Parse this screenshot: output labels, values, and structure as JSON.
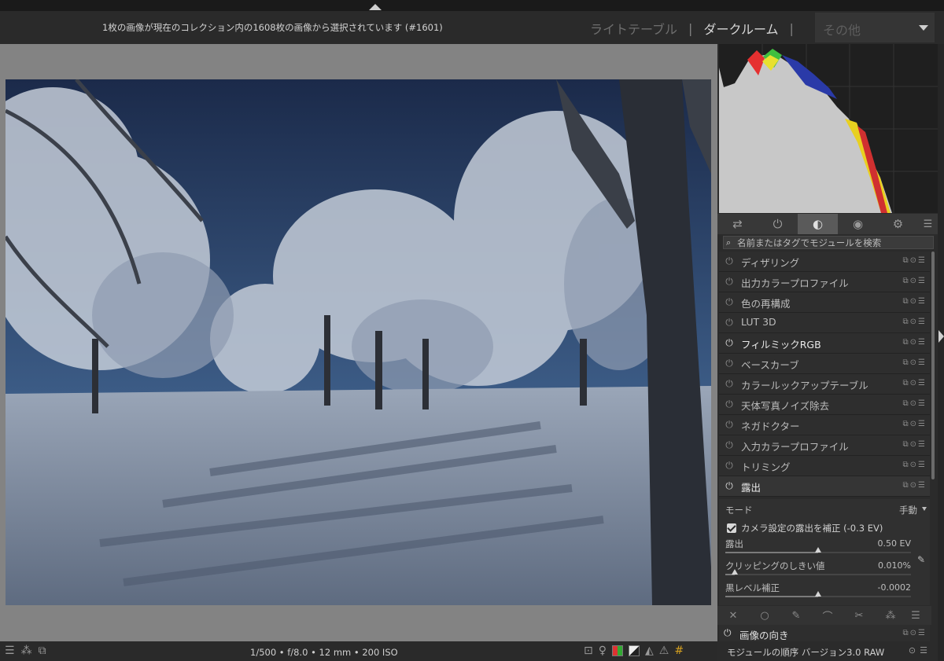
{
  "header": {
    "info": "1枚の画像が現在のコレクション内の1608枚の画像から選択されています (#1601)",
    "views": [
      {
        "label": "ライトテーブル",
        "active": false
      },
      {
        "label": "ダークルーム",
        "active": true
      }
    ],
    "separator": "|",
    "other_label": "その他"
  },
  "panel": {
    "tabs": [
      "⇄",
      "⏻",
      "◐",
      "◉",
      "⚙",
      "☰"
    ],
    "search": {
      "placeholder": "名前またはタグでモジュールを検索"
    },
    "modules": [
      {
        "name": "ディザリング",
        "on": false
      },
      {
        "name": "出力カラープロファイル",
        "on": false
      },
      {
        "name": "色の再構成",
        "on": false
      },
      {
        "name": "LUT 3D",
        "on": false
      },
      {
        "name": "フィルミックRGB",
        "on": true
      },
      {
        "name": "ベースカーブ",
        "on": false
      },
      {
        "name": "カラールックアップテーブル",
        "on": false
      },
      {
        "name": "天体写真ノイズ除去",
        "on": false
      },
      {
        "name": "ネガドクター",
        "on": false
      },
      {
        "name": "入力カラープロファイル",
        "on": false
      },
      {
        "name": "トリミング",
        "on": false
      },
      {
        "name": "露出",
        "on": true
      }
    ],
    "exposure": {
      "mode_label": "モード",
      "mode_value": "手動",
      "compensate_label": "カメラ設定の露出を補正 (-0.3 EV)",
      "compensate_checked": true,
      "sliders": [
        {
          "label": "露出",
          "value": "0.50 EV",
          "position": 0.5
        },
        {
          "label": "クリッピングのしきい値",
          "value": "0.010%",
          "position": 0.05
        },
        {
          "label": "黒レベル補正",
          "value": "-0.0002",
          "position": 0.5
        }
      ]
    },
    "mask_icons": [
      "✕",
      "○",
      "✎",
      "⌒",
      "✂",
      "⁂",
      "☰"
    ],
    "orientation_module": "画像の向き",
    "footer": {
      "order_label": "モジュールの順序",
      "version": "バージョン3.0 RAW"
    }
  },
  "bottom": {
    "exif": "1/500 • f/8.0 • 12 mm • 200 ISO"
  }
}
